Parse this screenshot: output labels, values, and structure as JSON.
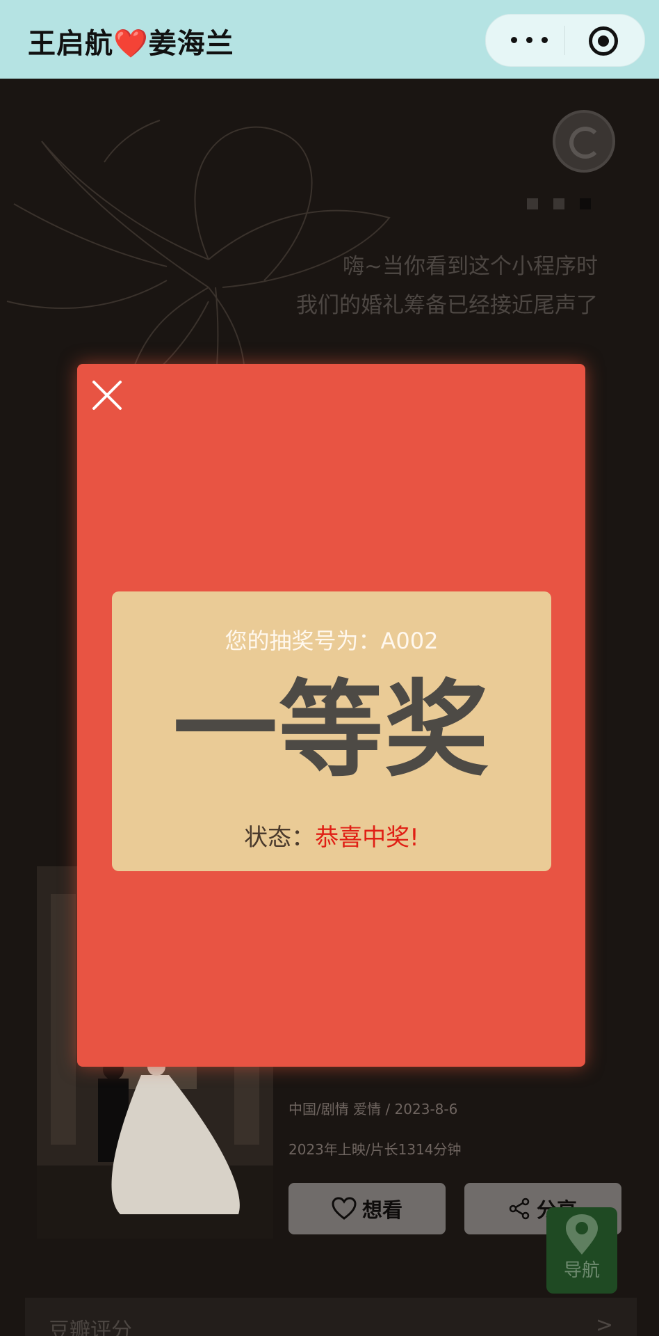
{
  "header": {
    "title": "王启航❤️姜海兰"
  },
  "intro": {
    "line1": "嗨~当你看到这个小程序时",
    "line2": "我们的婚礼筹备已经接近尾声了"
  },
  "movie": {
    "meta1": "中国/剧情 爱情 / 2023-8-6",
    "meta2": "2023年上映/片长1314分钟",
    "want_label": "想看",
    "share_label": "分享"
  },
  "nav_float": {
    "label": "导航"
  },
  "rating": {
    "label": "豆瓣评分",
    "arrow": ">"
  },
  "modal": {
    "lottery_prefix": "您的抽奖号为：",
    "lottery_number": "A002",
    "prize": "一等奖",
    "status_label": "状态：",
    "status_value": "恭喜中奖!"
  },
  "colors": {
    "topbar_bg": "#b5e3e3",
    "page_bg": "#1a1512",
    "modal_bg": "#e85443",
    "card_bg": "#eacb96",
    "status_ok": "#e01e14",
    "nav_bg": "#1f4a23"
  },
  "icons": {
    "capsule_more": "more-dots-icon",
    "capsule_close": "target-icon",
    "music": "music-disc-icon",
    "modal_close": "close-icon",
    "want": "heart-icon",
    "share": "share-icon",
    "nav": "location-pin-icon"
  }
}
